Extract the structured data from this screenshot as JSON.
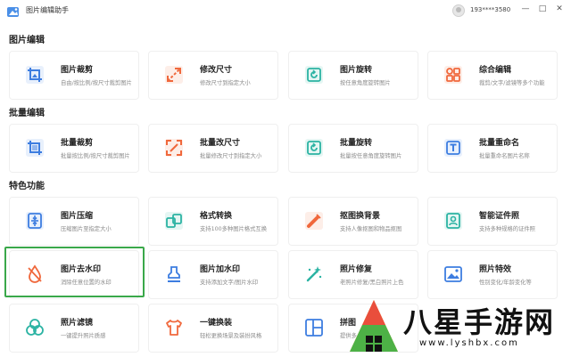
{
  "app": {
    "title": "图片编辑助手",
    "account": "193****3580",
    "controls": {
      "minimize": "—",
      "maximize": "□",
      "close": "✕"
    }
  },
  "sections": [
    {
      "title": "图片编辑"
    },
    {
      "title": "批量编辑"
    },
    {
      "title": "特色功能"
    }
  ],
  "cards": [
    {
      "name": "图片裁剪",
      "desc": "自由/按比例/按尺寸裁剪图片",
      "icon": "crop-icon",
      "color": "#3d7de0"
    },
    {
      "name": "修改尺寸",
      "desc": "修改尺寸到指定大小",
      "icon": "resize-icon",
      "color": "#f0683c"
    },
    {
      "name": "图片旋转",
      "desc": "按任意角度旋转图片",
      "icon": "rotate-icon",
      "color": "#2bb3a3"
    },
    {
      "name": "综合编辑",
      "desc": "裁剪/文字/滤镜等多个功能",
      "icon": "grid-icon",
      "color": "#f0683c"
    },
    {
      "name": "批量裁剪",
      "desc": "批量按比例/按尺寸裁剪图片",
      "icon": "crop-icon",
      "color": "#3d7de0"
    },
    {
      "name": "批量改尺寸",
      "desc": "批量修改尺寸到指定大小",
      "icon": "resize-icon",
      "color": "#f0683c"
    },
    {
      "name": "批量旋转",
      "desc": "批量按任意角度旋转图片",
      "icon": "rotate-icon",
      "color": "#2bb3a3"
    },
    {
      "name": "批量重命名",
      "desc": "批量重命名图片名称",
      "icon": "text-icon",
      "color": "#3d7de0"
    },
    {
      "name": "图片压缩",
      "desc": "压缩图片至指定大小",
      "icon": "compress-icon",
      "color": "#3d7de0"
    },
    {
      "name": "格式转换",
      "desc": "支持100多种图片格式互换",
      "icon": "convert-icon",
      "color": "#2bb3a3"
    },
    {
      "name": "抠图换背景",
      "desc": "支持人像抠图和物品抠图",
      "icon": "cutout-icon",
      "color": "#f0683c"
    },
    {
      "name": "智能证件照",
      "desc": "支持多种规格的证件照",
      "icon": "id-photo-icon",
      "color": "#2bb3a3"
    },
    {
      "name": "图片去水印",
      "desc": "消除任意位置的水印",
      "icon": "drop-icon",
      "color": "#f0683c"
    },
    {
      "name": "图片加水印",
      "desc": "支持添加文字/图片水印",
      "icon": "stamp-icon",
      "color": "#3d7de0"
    },
    {
      "name": "照片修复",
      "desc": "老照片修复/黑白照片上色",
      "icon": "magic-wand-icon",
      "color": "#2bb3a3"
    },
    {
      "name": "照片特效",
      "desc": "性别变化/年龄变化等",
      "icon": "image-effect-icon",
      "color": "#3d7de0"
    },
    {
      "name": "照片滤镜",
      "desc": "一键提升照片质感",
      "icon": "filter-icon",
      "color": "#2bb3a3"
    },
    {
      "name": "一键换装",
      "desc": "轻松更换场景及装扮风格",
      "icon": "shirt-icon",
      "color": "#f0683c"
    },
    {
      "name": "拼图",
      "desc": "提供多",
      "icon": "collage-icon",
      "color": "#3d7de0"
    }
  ],
  "watermark": {
    "text": "八星手游网",
    "url": "www.lyshbx.com"
  }
}
